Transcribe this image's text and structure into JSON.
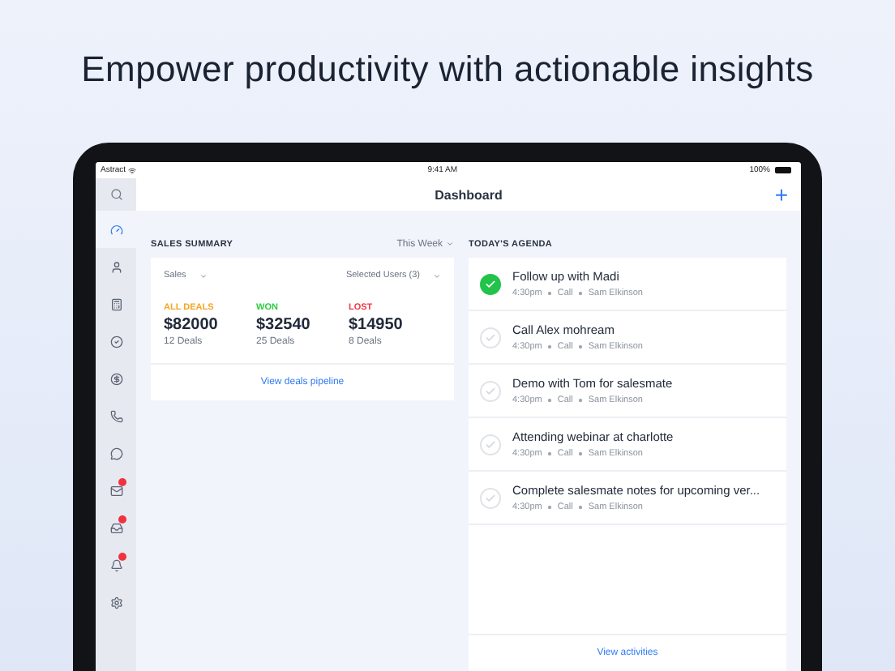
{
  "headline": "Empower productivity with actionable insights",
  "status_bar": {
    "carrier": "Astract",
    "time": "9:41 AM",
    "battery": "100%"
  },
  "nav": {
    "title": "Dashboard",
    "add": "+"
  },
  "sidebar": {
    "items": [
      {
        "selected": true,
        "badge": false
      },
      {
        "selected": false,
        "badge": false
      },
      {
        "selected": false,
        "badge": false
      },
      {
        "selected": false,
        "badge": false
      },
      {
        "selected": false,
        "badge": false
      },
      {
        "selected": false,
        "badge": false
      },
      {
        "selected": false,
        "badge": false
      },
      {
        "selected": false,
        "badge": true
      },
      {
        "selected": false,
        "badge": true
      },
      {
        "selected": false,
        "badge": true
      },
      {
        "selected": false,
        "badge": false
      }
    ]
  },
  "sales_summary": {
    "title": "SALES SUMMARY",
    "period": "This Week",
    "pipeline_select": "Sales",
    "users_select": "Selected Users (3)",
    "stats": [
      {
        "label": "ALL DEALS",
        "color": "#f5a623",
        "amount": "$82000",
        "count": "12 Deals"
      },
      {
        "label": "WON",
        "color": "#2ecc40",
        "amount": "$32540",
        "count": "25 Deals"
      },
      {
        "label": "LOST",
        "color": "#f03a47",
        "amount": "$14950",
        "count": "8 Deals"
      }
    ],
    "link": "View deals pipeline"
  },
  "agenda": {
    "title": "TODAY'S AGENDA",
    "items": [
      {
        "title": "Follow up with Madi",
        "time": "4:30pm",
        "type": "Call",
        "owner": "Sam Elkinson",
        "checked": true
      },
      {
        "title": "Call Alex mohream",
        "time": "4:30pm",
        "type": "Call",
        "owner": "Sam Elkinson",
        "checked": false
      },
      {
        "title": "Demo with Tom for salesmate",
        "time": "4:30pm",
        "type": "Call",
        "owner": "Sam Elkinson",
        "checked": false
      },
      {
        "title": "Attending webinar at charlotte",
        "time": "4:30pm",
        "type": "Call",
        "owner": "Sam Elkinson",
        "checked": false
      },
      {
        "title": "Complete salesmate notes for upcoming ver...",
        "time": "4:30pm",
        "type": "Call",
        "owner": "Sam Elkinson",
        "checked": false
      }
    ],
    "link": "View activities"
  }
}
